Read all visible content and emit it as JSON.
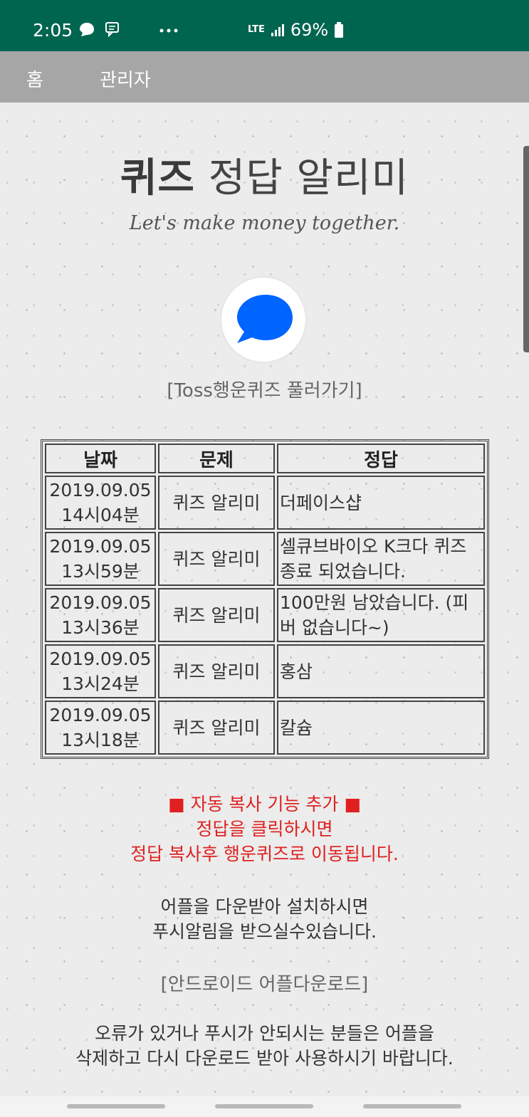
{
  "status_bar": {
    "time": "2:05",
    "network": "LTE",
    "battery": "69%"
  },
  "nav": {
    "home": "홈",
    "admin": "관리자"
  },
  "header": {
    "title_bold": "퀴즈",
    "title_rest": "정답 알리미",
    "subtitle": "Let's make money together."
  },
  "toss_link": "[Toss행운퀴즈 풀러가기]",
  "table": {
    "headers": [
      "날짜",
      "문제",
      "정답"
    ],
    "rows": [
      {
        "date": "2019.09.05",
        "time": "14시04분",
        "question": "퀴즈 알리미",
        "answer": "더페이스샵"
      },
      {
        "date": "2019.09.05",
        "time": "13시59분",
        "question": "퀴즈 알리미",
        "answer": "셀큐브바이오 K크다 퀴즈 종료 되었습니다."
      },
      {
        "date": "2019.09.05",
        "time": "13시36분",
        "question": "퀴즈 알리미",
        "answer": "100만원 남았습니다. (피버 없습니다~)"
      },
      {
        "date": "2019.09.05",
        "time": "13시24분",
        "question": "퀴즈 알리미",
        "answer": "홍삼"
      },
      {
        "date": "2019.09.05",
        "time": "13시18분",
        "question": "퀴즈 알리미",
        "answer": "칼슘"
      }
    ]
  },
  "notice": {
    "line1": "■ 자동 복사 기능 추가 ■",
    "line2": "정답을 클릭하시면",
    "line3": "정답 복사후 행운퀴즈로 이동됩니다."
  },
  "info1": {
    "line1": "어플을 다운받아 설치하시면",
    "line2": "푸시알림을 받으실수있습니다."
  },
  "app_link": "[안드로이드 어플다운로드]",
  "info2": {
    "line1": "오류가 있거나 푸시가 안되시는 분들은 어플을",
    "line2": "삭제하고 다시 다운로드 받아 사용하시기 바랍니다."
  },
  "colors": {
    "status_bar": "#00654f",
    "nav_bar": "#a6a6a6",
    "notice": "#e02020",
    "toss_blue": "#0064ff"
  },
  "icons": [
    "chat-bubble-icon",
    "message-icon",
    "more-dots-icon",
    "signal-icon",
    "battery-icon",
    "toss-logo-icon"
  ]
}
